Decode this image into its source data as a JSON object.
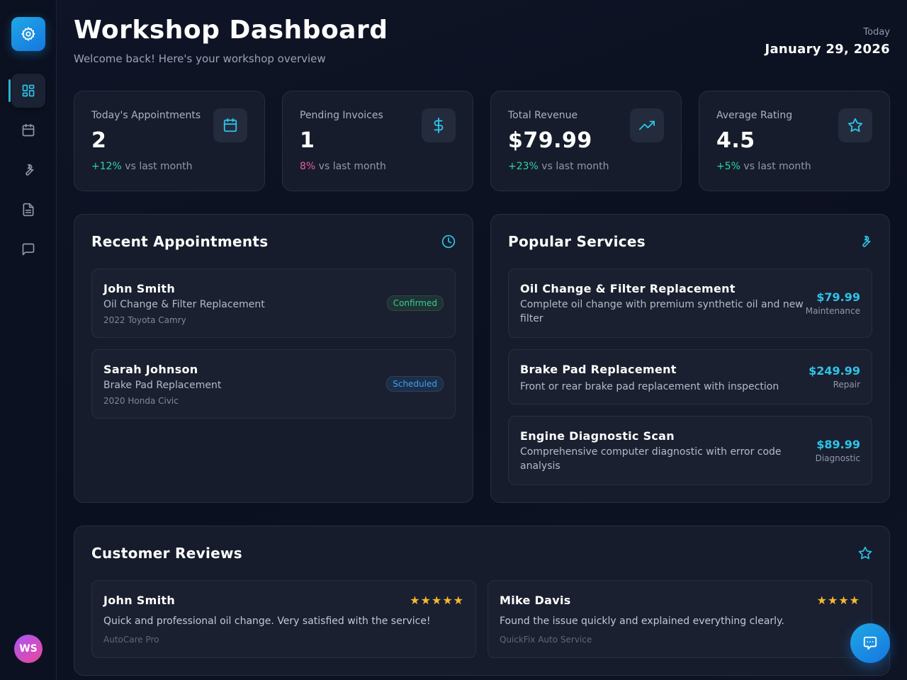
{
  "header": {
    "title": "Workshop Dashboard",
    "subtitle": "Welcome back! Here's your workshop overview",
    "date_label": "Today",
    "date": "January 29, 2026"
  },
  "sidebar": {
    "logo_icon": "gear-icon",
    "items": [
      {
        "icon": "dashboard-icon",
        "active": true
      },
      {
        "icon": "calendar-icon",
        "active": false
      },
      {
        "icon": "wrench-icon",
        "active": false
      },
      {
        "icon": "document-icon",
        "active": false
      },
      {
        "icon": "message-icon",
        "active": false
      }
    ],
    "avatar_initials": "WS"
  },
  "stats": [
    {
      "label": "Today's Appointments",
      "value": "2",
      "change": "+12%",
      "change_suffix": " vs last month",
      "icon": "calendar-icon"
    },
    {
      "label": "Pending Invoices",
      "value": "1",
      "change": "8%",
      "change_suffix": " vs last month",
      "icon": "dollar-icon"
    },
    {
      "label": "Total Revenue",
      "value": "$79.99",
      "change": "+23%",
      "change_suffix": " vs last month",
      "icon": "trending-up-icon"
    },
    {
      "label": "Average Rating",
      "value": "4.5",
      "change": "+5%",
      "change_suffix": " vs last month",
      "icon": "star-icon"
    }
  ],
  "appointments": {
    "title": "Recent Appointments",
    "items": [
      {
        "name": "John Smith",
        "service": "Oil Change & Filter Replacement",
        "vehicle": "2022 Toyota Camry",
        "status": "Confirmed"
      },
      {
        "name": "Sarah Johnson",
        "service": "Brake Pad Replacement",
        "vehicle": "2020 Honda Civic",
        "status": "Scheduled"
      }
    ]
  },
  "services": {
    "title": "Popular Services",
    "items": [
      {
        "name": "Oil Change & Filter Replacement",
        "desc": "Complete oil change with premium synthetic oil and new filter",
        "price": "$79.99",
        "category": "Maintenance"
      },
      {
        "name": "Brake Pad Replacement",
        "desc": "Front or rear brake pad replacement with inspection",
        "price": "$249.99",
        "category": "Repair"
      },
      {
        "name": "Engine Diagnostic Scan",
        "desc": "Comprehensive computer diagnostic with error code analysis",
        "price": "$89.99",
        "category": "Diagnostic"
      }
    ]
  },
  "reviews": {
    "title": "Customer Reviews",
    "items": [
      {
        "name": "John Smith",
        "rating": 5,
        "stars": "★★★★★",
        "text": "Quick and professional oil change. Very satisfied with the service!",
        "shop": "AutoCare Pro"
      },
      {
        "name": "Mike Davis",
        "rating": 4,
        "stars": "★★★★",
        "text": "Found the issue quickly and explained everything clearly.",
        "shop": "QuickFix Auto Service"
      }
    ]
  },
  "colors": {
    "accent": "#2ec4e8",
    "positive": "#2dd4a8",
    "neutral_change": "#e85aa8",
    "star": "#f5b82e"
  }
}
